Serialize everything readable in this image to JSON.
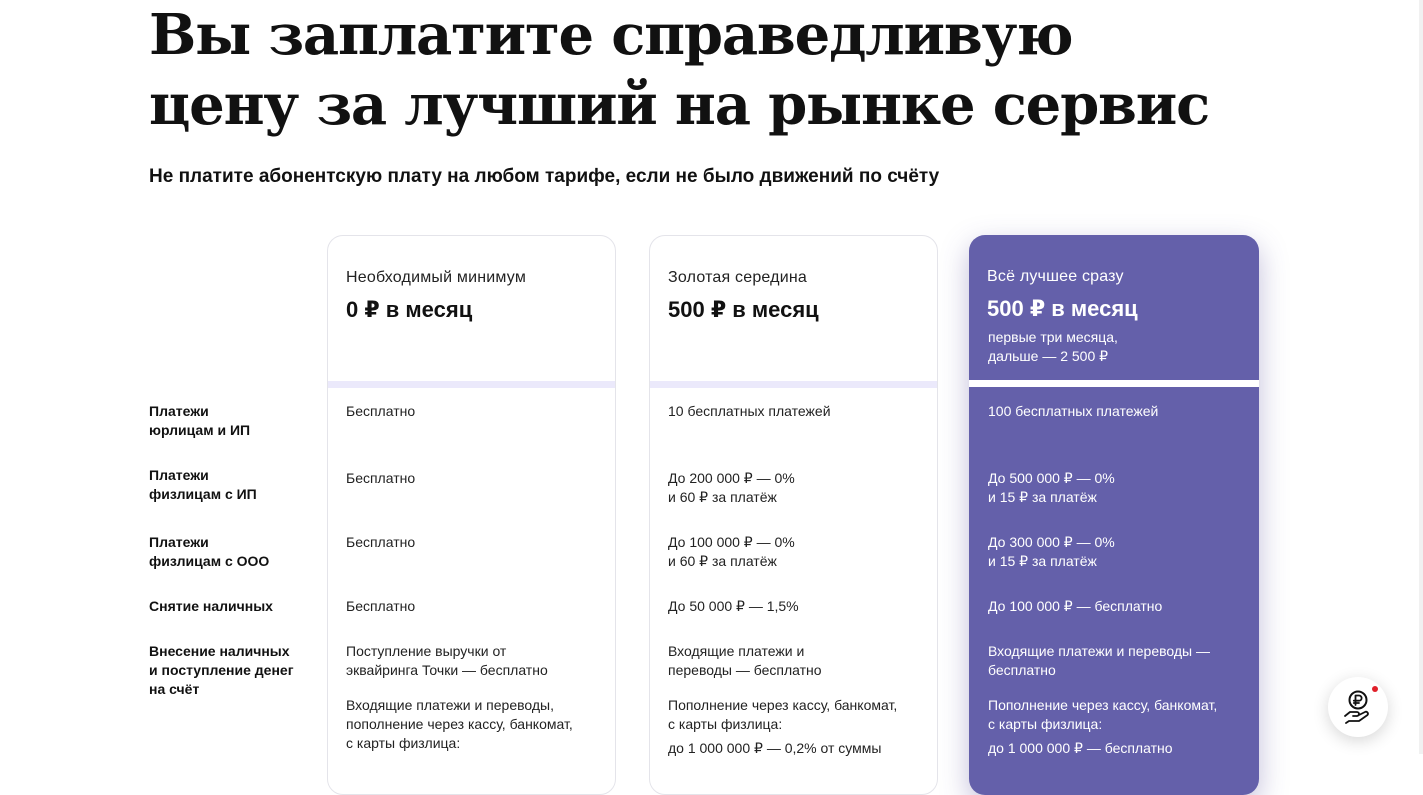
{
  "header": {
    "title": "Вы заплатите справедливую цену за лучший на рынке сервис",
    "subtitle": "Не платите абонентскую плату на любом тарифе, если не было движений по счёту"
  },
  "plans": [
    {
      "name": "Необходимый минимум",
      "price": "0 ₽ в месяц",
      "note": ""
    },
    {
      "name": "Золотая середина",
      "price": "500 ₽ в месяц",
      "note": ""
    },
    {
      "name": "Всё лучшее сразу",
      "price": "500 ₽ в месяц",
      "note_line1": "первые три месяца,",
      "note_line2": "дальше — 2 500 ₽",
      "highlight_color": "#6460aa"
    }
  ],
  "rows": [
    {
      "label_line1": "Платежи",
      "label_line2": "юрлицам и ИП",
      "values": [
        "Бесплатно",
        "10 бесплатных платежей",
        "100 бесплатных платежей"
      ]
    },
    {
      "label_line1": "Платежи",
      "label_line2": "физлицам с ИП",
      "values": [
        [
          "Бесплатно"
        ],
        [
          "До 200 000 ₽ — 0%",
          "и 60 ₽ за платёж"
        ],
        [
          "До 500 000 ₽ — 0%",
          "и 15 ₽ за платёж"
        ]
      ]
    },
    {
      "label_line1": "Платежи",
      "label_line2": "физлицам с ООО",
      "values": [
        [
          "Бесплатно"
        ],
        [
          "До 100 000 ₽ — 0%",
          "и 60 ₽ за платёж"
        ],
        [
          "До 300 000 ₽ — 0%",
          "и 15 ₽ за платёж"
        ]
      ]
    },
    {
      "label_line1": "Снятие наличных",
      "values": [
        "Бесплатно",
        "До 50 000 ₽ — 1,5%",
        "До 100 000 ₽ — бесплатно"
      ]
    },
    {
      "label_line1": "Внесение наличных",
      "label_line2": "и поступление денег",
      "label_line3": "на счёт",
      "values": [
        {
          "p1_l1": "Поступление выручки от",
          "p1_l2": "эквайринга Точки — бесплатно",
          "p2_l1": "Входящие платежи и переводы,",
          "p2_l2": "пополнение через кассу, банкомат,",
          "p2_l3": "с карты физлица:"
        },
        {
          "p1_l1": "Входящие платежи и",
          "p1_l2": "переводы — бесплатно",
          "p2_l1": "Пополнение через кассу, банкомат,",
          "p2_l2": "с карты физлица:",
          "p2_l3": "до 1 000 000 ₽ — 0,2% от суммы"
        },
        {
          "p1_l1": "Входящие платежи и переводы —",
          "p1_l2": "бесплатно",
          "p2_l1": "Пополнение через кассу, банкомат,",
          "p2_l2": "с карты физлица:",
          "p2_l3": "до 1 000 000 ₽ — бесплатно"
        }
      ]
    }
  ],
  "chat_button": {
    "icon": "ruble-coin-hand-icon",
    "badge_color": "#e0202a"
  }
}
